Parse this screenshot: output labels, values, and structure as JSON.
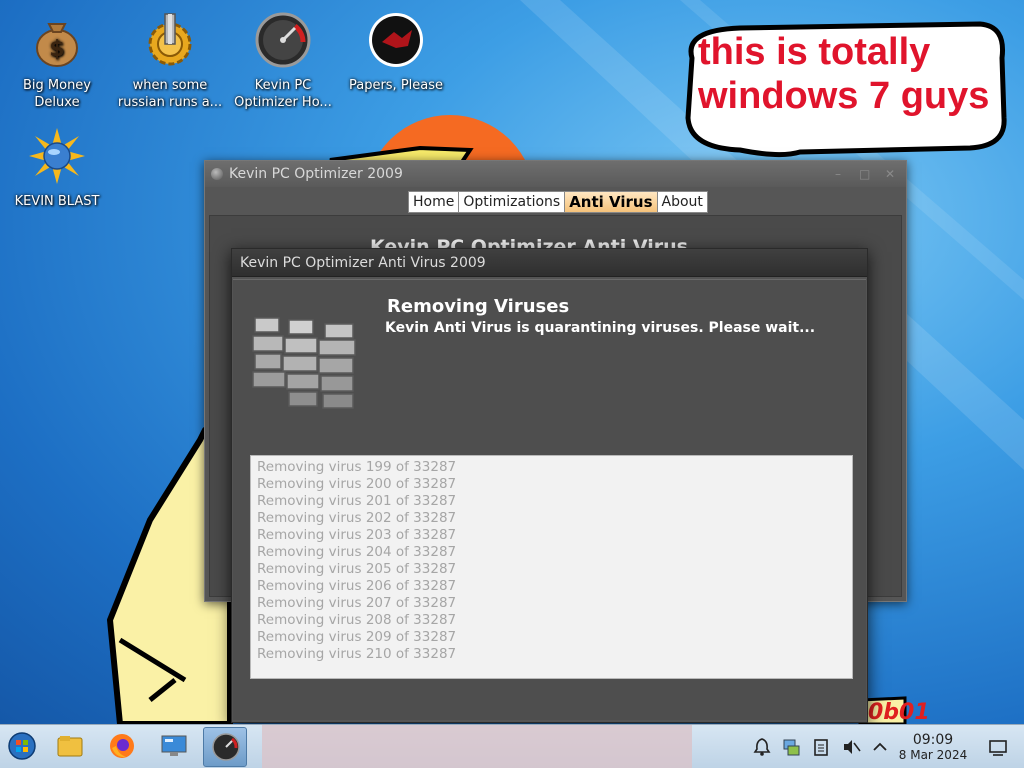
{
  "desktop": {
    "icons": [
      {
        "label": "Big Money Deluxe",
        "icon": "money-bag-icon"
      },
      {
        "label": "when some russian runs a...",
        "icon": "gear-icon"
      },
      {
        "label": "Kevin PC Optimizer Ho...",
        "icon": "speedometer-icon"
      },
      {
        "label": "Papers, Please",
        "icon": "papers-please-icon"
      },
      {
        "label": "KEVIN BLAST",
        "icon": "globe-burst-icon"
      }
    ],
    "meme_text": "this is totally windows 7 guys",
    "watermark": "0b01"
  },
  "main_window": {
    "title": "Kevin PC Optimizer 2009",
    "tabs": [
      {
        "label": "Home",
        "active": false
      },
      {
        "label": "Optimizations",
        "active": false
      },
      {
        "label": "Anti Virus",
        "active": true
      },
      {
        "label": "About",
        "active": false
      }
    ],
    "heading": "Kevin PC Optimizer Anti Virus",
    "controls": {
      "minimize": "–",
      "maximize": "□",
      "close": "✕"
    }
  },
  "av_dialog": {
    "title": "Kevin PC Optimizer Anti Virus 2009",
    "heading": "Removing Viruses",
    "subheading": "Kevin Anti Virus is quarantining viruses. Please wait...",
    "icon": "firewall-brick-wall-icon",
    "log": [
      "Removing virus 199 of 33287",
      "Removing virus 200 of 33287",
      "Removing virus 201 of 33287",
      "Removing virus 202 of 33287",
      "Removing virus 203 of 33287",
      "Removing virus 204 of 33287",
      "Removing virus 205 of 33287",
      "Removing virus 206 of 33287",
      "Removing virus 207 of 33287",
      "Removing virus 208 of 33287",
      "Removing virus 209 of 33287",
      "Removing virus 210 of 33287"
    ]
  },
  "taskbar": {
    "apps": [
      "start-orb-icon",
      "file-manager-icon",
      "firefox-icon",
      "monitor-settings-icon",
      "kevin-optimizer-icon"
    ],
    "tray": [
      "notification-bell-icon",
      "network-icon",
      "clipboard-icon",
      "volume-muted-icon",
      "chevron-up-icon",
      "show-desktop-icon"
    ],
    "time": "09:09",
    "date": "8 Mar 2024"
  },
  "colors": {
    "accent_tab": "#f5c27a",
    "meme_red": "#e0142c",
    "window_dark": "#4e4e4e"
  }
}
